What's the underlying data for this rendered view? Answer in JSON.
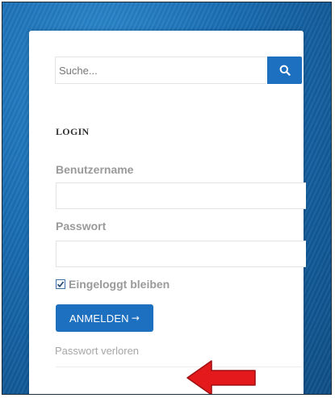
{
  "search": {
    "placeholder": "Suche...",
    "icon": "search-icon"
  },
  "login": {
    "heading": "LOGIN",
    "username_label": "Benutzername",
    "username_value": "",
    "password_label": "Passwort",
    "password_value": "",
    "remember_label": "Eingeloggt bleiben",
    "remember_checked": true,
    "submit_label": "ANMELDEN",
    "submit_arrow": "→",
    "forgot_label": "Passwort verloren"
  },
  "colors": {
    "accent": "#1d6fbf",
    "background": "#1a6fb5",
    "annotation_arrow": "#e3191c"
  }
}
